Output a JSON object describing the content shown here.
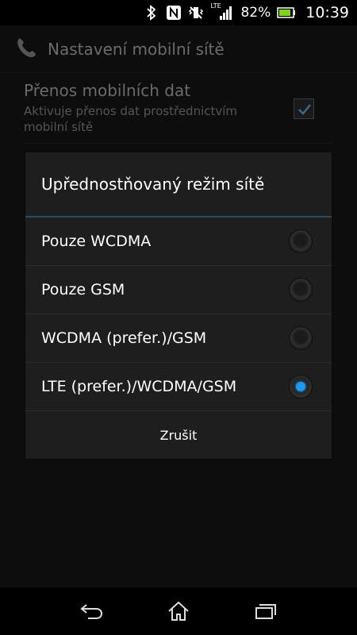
{
  "status_bar": {
    "icons": [
      "bluetooth-icon",
      "nfc-icon",
      "vibrate-icon",
      "lte-signal-icon",
      "battery-icon"
    ],
    "network_label": "LTE",
    "battery_percent": "82%",
    "time": "10:39"
  },
  "background": {
    "title": "Nastavení mobilní sítě",
    "pref": {
      "title": "Přenos mobilních dat",
      "summary": "Aktivuje přenos dat prostřednictvím mobilní sítě",
      "checked": true
    }
  },
  "dialog": {
    "title": "Upřednostňovaný režim sítě",
    "options": [
      {
        "label": "Pouze WCDMA",
        "selected": false
      },
      {
        "label": "Pouze GSM",
        "selected": false
      },
      {
        "label": "WCDMA (prefer.)/GSM",
        "selected": false
      },
      {
        "label": "LTE (prefer.)/WCDMA/GSM",
        "selected": true
      }
    ],
    "cancel_label": "Zrušit",
    "accent_color": "#1a9af3"
  },
  "nav_bar": {
    "buttons": [
      "back-icon",
      "home-icon",
      "recent-apps-icon"
    ]
  }
}
